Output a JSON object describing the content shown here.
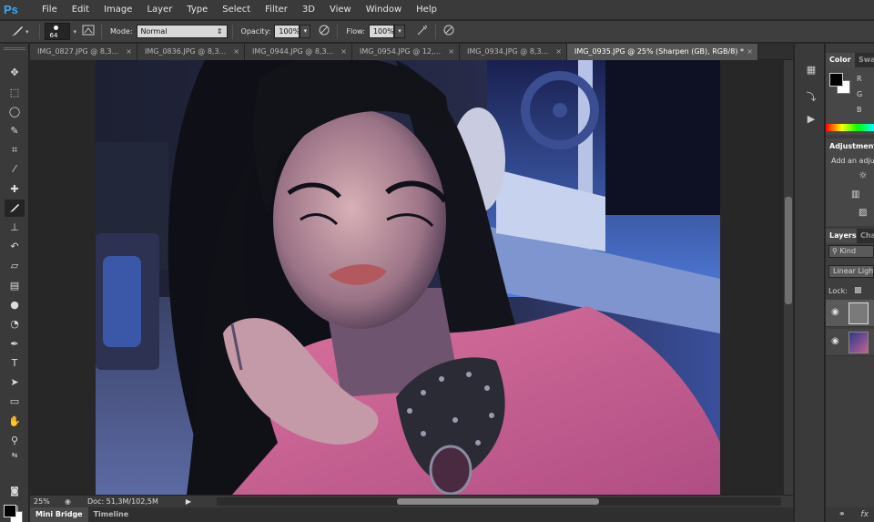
{
  "app": {
    "logo": "Ps"
  },
  "menu": [
    "File",
    "Edit",
    "Image",
    "Layer",
    "Type",
    "Select",
    "Filter",
    "3D",
    "View",
    "Window",
    "Help"
  ],
  "options": {
    "brush_size": "64",
    "mode_label": "Mode:",
    "mode_value": "Normal",
    "opacity_label": "Opacity:",
    "opacity_value": "100%",
    "flow_label": "Flow:",
    "flow_value": "100%"
  },
  "tabs": [
    {
      "label": "IMG_0827.JPG @ 8,3...",
      "active": false
    },
    {
      "label": "IMG_0836.JPG @ 8,3...",
      "active": false
    },
    {
      "label": "IMG_0944.JPG @ 8,3...",
      "active": false
    },
    {
      "label": "IMG_0954.JPG @ 12,...",
      "active": false
    },
    {
      "label": "IMG_0934.JPG @ 8,3...",
      "active": false
    },
    {
      "label": "IMG_0935.JPG @ 25% (Sharpen (GB), RGB/8) *",
      "active": true
    }
  ],
  "tab_close_glyph": "×",
  "status": {
    "zoom": "25%",
    "doc": "Doc: 51,3M/102,5M"
  },
  "bottom_tabs": [
    "Mini Bridge",
    "Timeline"
  ],
  "panels": {
    "color_tab": "Color",
    "swatches_tab": "Swat",
    "rgb": [
      "R",
      "G",
      "B"
    ],
    "adjustments_title": "Adjustments",
    "adjustments_hint": "Add an adju",
    "layers_tab": "Layers",
    "channels_tab": "Cha",
    "kind_label": "Kind",
    "blend_mode": "Linear Light",
    "lock_label": "Lock:"
  },
  "colors": {
    "foreground": "#000000",
    "background": "#ffffff",
    "accent": "#3fa6ee"
  },
  "icons": {
    "tools": [
      "move-icon",
      "marquee-icon",
      "lasso-icon",
      "quick-select-icon",
      "crop-icon",
      "eyedropper-icon",
      "healing-icon",
      "brush-icon",
      "stamp-icon",
      "history-brush-icon",
      "eraser-icon",
      "gradient-icon",
      "blur-icon",
      "dodge-icon",
      "pen-icon",
      "type-icon",
      "path-select-icon",
      "shape-icon",
      "hand-icon",
      "zoom-icon"
    ]
  }
}
